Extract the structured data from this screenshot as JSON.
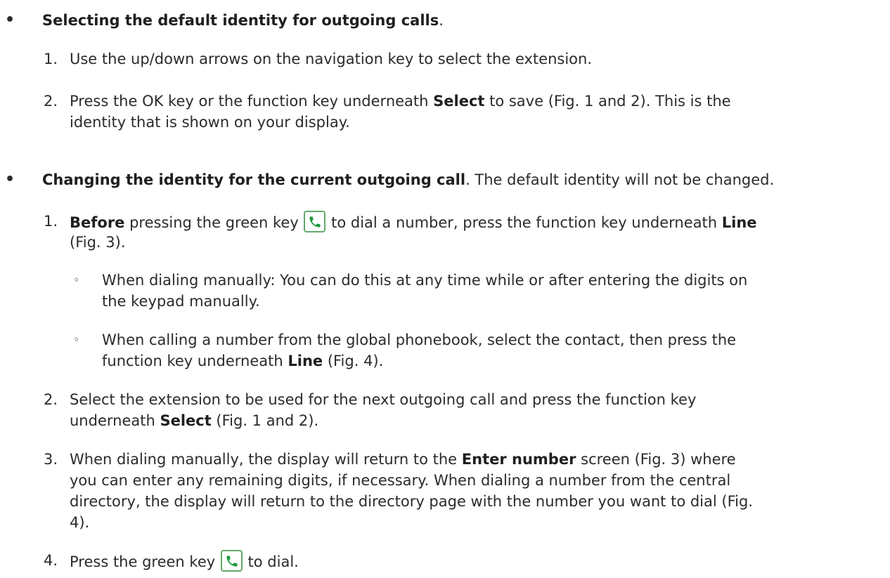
{
  "section1": {
    "bullet": "•",
    "title": "Selecting the default identity for outgoing calls",
    "title_end": ".",
    "steps": [
      {
        "num": "1.",
        "text": "Use the up/down arrows on the navigation key to select the extension."
      },
      {
        "num": "2.",
        "a": "Press the OK key or the function key underneath ",
        "b": "Select",
        "c": " to save (Fig. 1 and 2).  This is the",
        "line2": "identity that is shown on your display."
      }
    ]
  },
  "section2": {
    "bullet": "•",
    "title": "Changing the identity for the current outgoing call",
    "title_rest": ".  The default identity will not be changed.",
    "step1": {
      "num": "1.",
      "a": "Before",
      "b": " pressing the green key ",
      "c": " to dial a number, press the function key underneath ",
      "d": "Line",
      "line2": "(Fig. 3).",
      "subs": [
        {
          "mark": "◦",
          "line1": "When dialing manually:  You can do this at any time while or after entering the digits on",
          "line2": "the keypad manually."
        },
        {
          "mark": "◦",
          "line1": "When calling a number from the global phonebook, select the contact, then press the",
          "line2a": "function key underneath ",
          "line2b": "Line",
          "line2c": " (Fig. 4)."
        }
      ]
    },
    "step2": {
      "num": "2.",
      "line1": "Select the extension to be used for the next outgoing call and press the function key",
      "line2a": "underneath ",
      "line2b": "Select",
      "line2c": " (Fig. 1 and 2)."
    },
    "step3": {
      "num": "3.",
      "line1a": "When dialing manually, the display will return to the ",
      "line1b": "Enter number",
      "line1c": " screen (Fig. 3) where",
      "line2": "you can enter any remaining digits, if necessary.  When dialing a number from the central",
      "line3": "directory, the display will return to the directory page with the number you want to dial (Fig.",
      "line4": "4)."
    },
    "step4": {
      "num": "4.",
      "a": "Press the green key ",
      "b": " to dial."
    }
  },
  "icons": {
    "green_key": "phone-handset-icon",
    "accent": "#1a9a3c"
  }
}
